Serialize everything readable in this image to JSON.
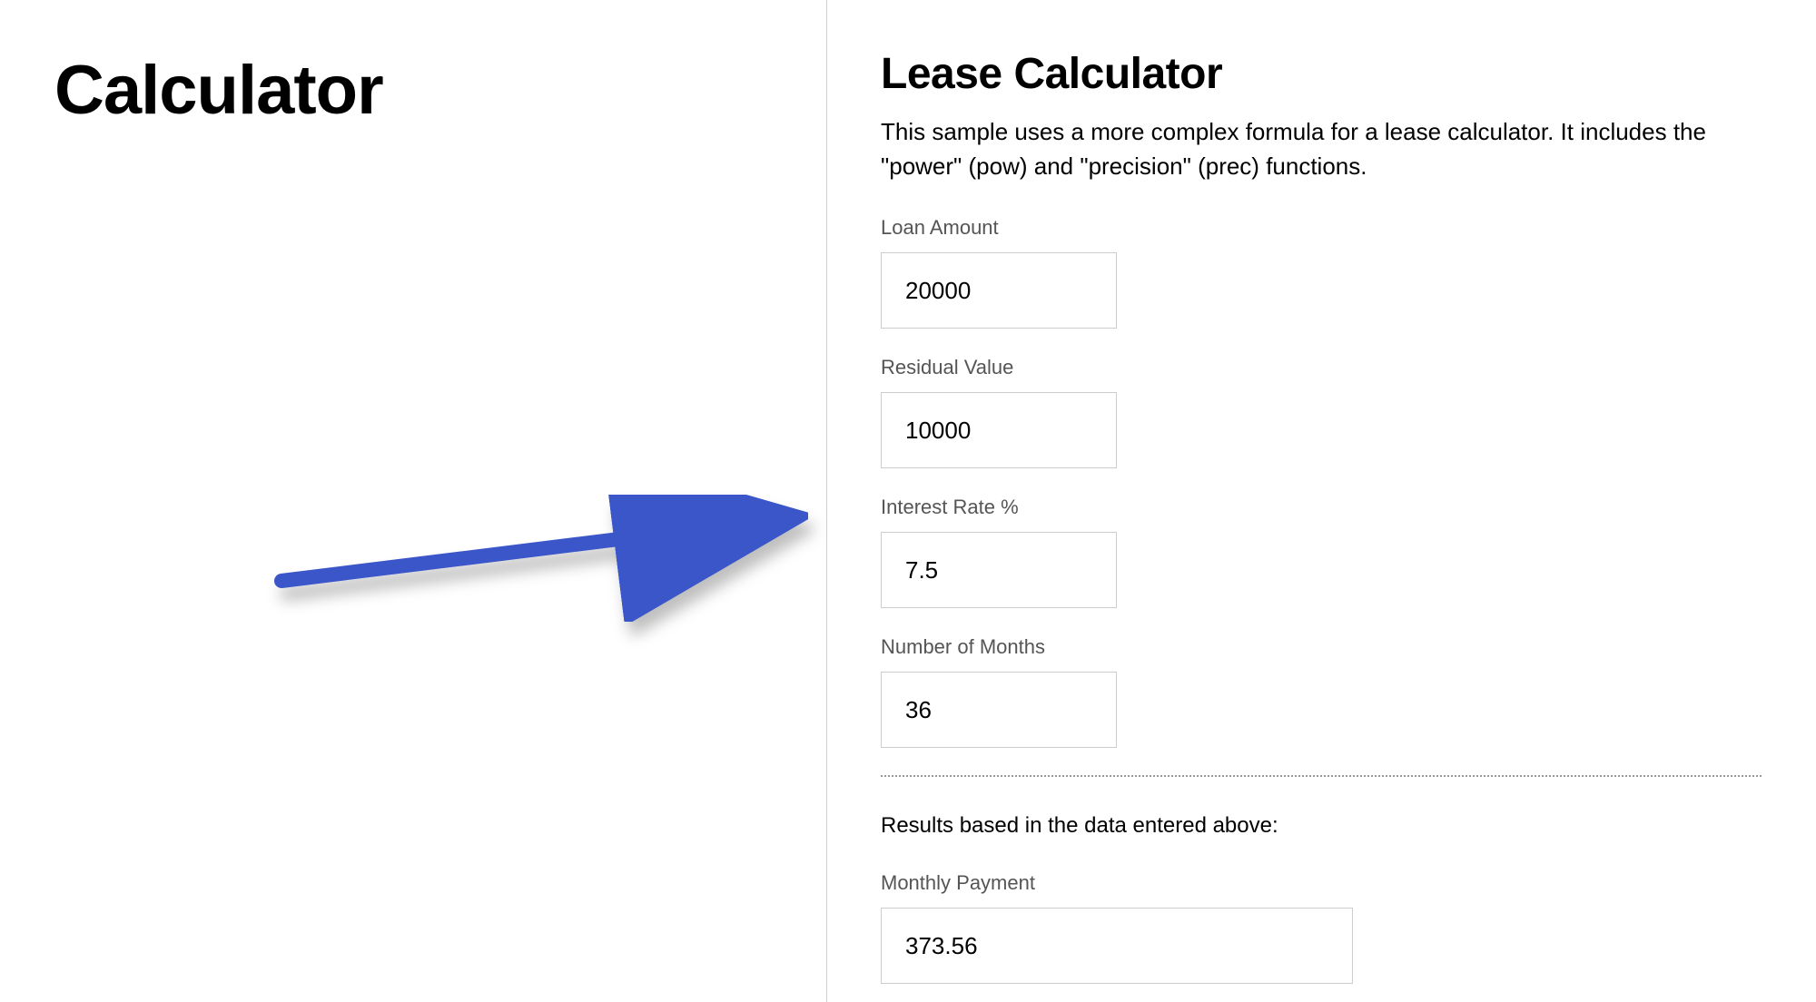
{
  "left": {
    "title": "Calculator"
  },
  "right": {
    "title": "Lease Calculator",
    "description": "This sample uses a more complex formula for a lease calculator. It includes the \"power\" (pow) and \"precision\" (prec) functions.",
    "fields": {
      "loanAmount": {
        "label": "Loan Amount",
        "value": "20000"
      },
      "residualValue": {
        "label": "Residual Value",
        "value": "10000"
      },
      "interestRate": {
        "label": "Interest Rate %",
        "value": "7.5"
      },
      "numMonths": {
        "label": "Number of Months",
        "value": "36"
      }
    },
    "resultsText": "Results based in the data entered above:",
    "result": {
      "label": "Monthly Payment",
      "value": "373.56"
    }
  },
  "annotation": {
    "arrowColor": "#3a56c9"
  }
}
